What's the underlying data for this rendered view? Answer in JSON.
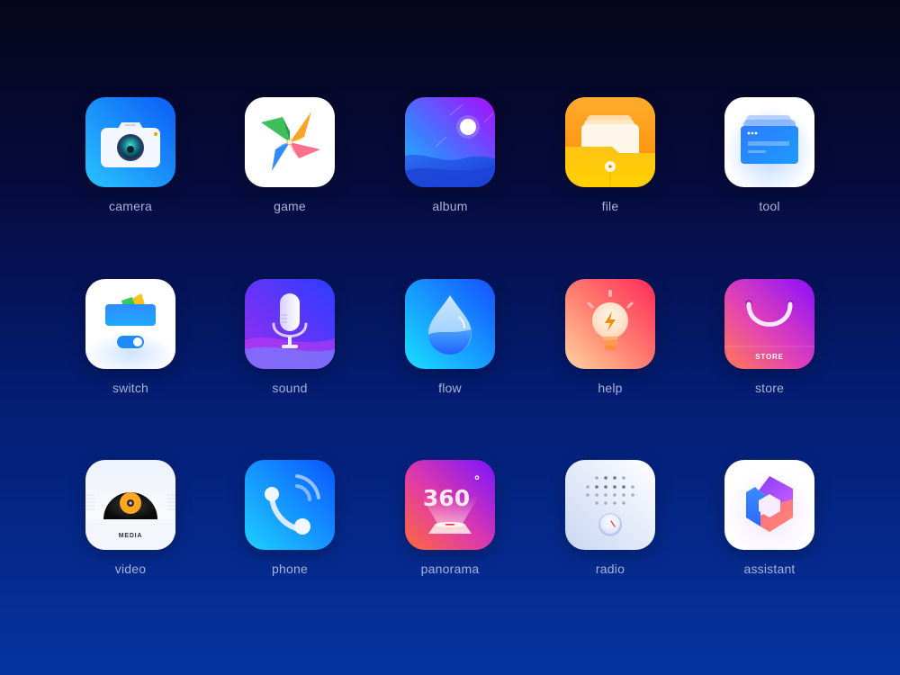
{
  "background": {
    "top_color": "#06061a",
    "bottom_color": "#0533a0"
  },
  "label_color": "#a9b3d6",
  "icons": [
    {
      "id": "camera",
      "label": "camera",
      "icon": "camera-icon"
    },
    {
      "id": "game",
      "label": "game",
      "icon": "pinwheel-icon"
    },
    {
      "id": "album",
      "label": "album",
      "icon": "landscape-icon"
    },
    {
      "id": "file",
      "label": "file",
      "icon": "folder-icon"
    },
    {
      "id": "tool",
      "label": "tool",
      "icon": "window-cards-icon"
    },
    {
      "id": "switch",
      "label": "switch",
      "icon": "wallet-toggle-icon"
    },
    {
      "id": "sound",
      "label": "sound",
      "icon": "microphone-icon"
    },
    {
      "id": "flow",
      "label": "flow",
      "icon": "water-drop-icon"
    },
    {
      "id": "help",
      "label": "help",
      "icon": "lightbulb-icon"
    },
    {
      "id": "store",
      "label": "store",
      "icon": "shopping-bag-icon",
      "badge_text": "STORE"
    },
    {
      "id": "video",
      "label": "video",
      "icon": "vinyl-record-icon",
      "badge_text": "MEDIA"
    },
    {
      "id": "phone",
      "label": "phone",
      "icon": "phone-handset-icon"
    },
    {
      "id": "panorama",
      "label": "panorama",
      "icon": "hologram-360-icon",
      "badge_text": "360",
      "badge_suffix": "°"
    },
    {
      "id": "radio",
      "label": "radio",
      "icon": "radio-speaker-icon"
    },
    {
      "id": "assistant",
      "label": "assistant",
      "icon": "hexagon-assistant-icon"
    }
  ]
}
